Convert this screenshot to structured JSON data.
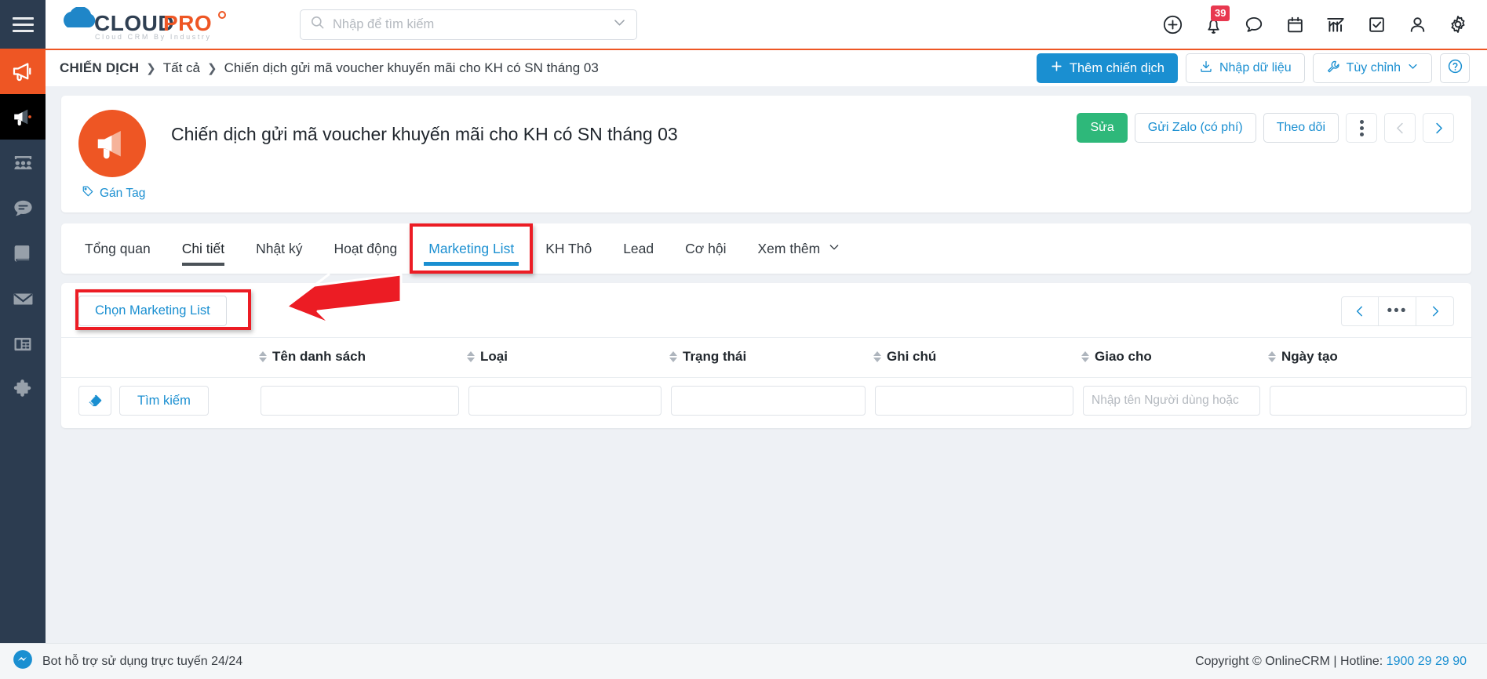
{
  "brand": {
    "name": "CLOUDPRO",
    "tagline": "Cloud CRM By Industry"
  },
  "topbar": {
    "menu_icon": "hamburger-icon",
    "search": {
      "placeholder": "Nhập để tìm kiếm",
      "value": ""
    },
    "icons": [
      {
        "name": "add-icon",
        "label": ""
      },
      {
        "name": "notification-bell-icon",
        "badge": "39"
      },
      {
        "name": "chat-bubble-icon",
        "label": ""
      },
      {
        "name": "calendar-icon",
        "label": ""
      },
      {
        "name": "analytics-chart-icon",
        "label": ""
      },
      {
        "name": "task-checkbox-icon",
        "label": ""
      },
      {
        "name": "user-profile-icon",
        "label": ""
      },
      {
        "name": "settings-gear-icon",
        "label": ""
      }
    ]
  },
  "sidebar": {
    "items": [
      {
        "name": "campaign-megaphone-icon",
        "state": "active"
      },
      {
        "name": "campaign-sub-megaphone-icon",
        "state": "sub"
      },
      {
        "name": "customers-group-icon",
        "state": ""
      },
      {
        "name": "chat-message-icon",
        "state": ""
      },
      {
        "name": "book-icon",
        "state": ""
      },
      {
        "name": "email-envelope-icon",
        "state": ""
      },
      {
        "name": "news-article-icon",
        "state": ""
      },
      {
        "name": "puzzle-extension-icon",
        "state": ""
      }
    ]
  },
  "breadcrumb": {
    "root": "CHIẾN DỊCH",
    "sep": "❯",
    "level1": "Tất cả",
    "level2": "Chiến dịch gửi mã voucher khuyến mãi cho KH có SN tháng 03"
  },
  "crumb_actions": {
    "add_campaign": "Thêm chiến dịch",
    "add_campaign_icon": "plus-icon",
    "import": "Nhập dữ liệu",
    "import_icon": "download-import-icon",
    "customize": "Tùy chỉnh",
    "customize_icon": "wrench-icon",
    "customize_chevron": "chevron-down-icon",
    "help_icon": "question-circle-icon"
  },
  "campaign": {
    "avatar_icon": "megaphone-icon",
    "avatar_color": "#ee5624",
    "title": "Chiến dịch gửi mã voucher khuyến mãi cho KH có SN tháng 03",
    "tag_link": "Gán Tag",
    "tag_icon": "tag-icon",
    "actions": {
      "edit": "Sửa",
      "send_zalo": "Gửi Zalo (có phí)",
      "follow": "Theo dõi",
      "more_icon": "kebab-menu-icon",
      "prev_icon": "chevron-left-icon",
      "next_icon": "chevron-right-icon"
    }
  },
  "tabs": [
    {
      "label": "Tổng quan",
      "state": ""
    },
    {
      "label": "Chi tiết",
      "state": "active-dark"
    },
    {
      "label": "Nhật ký",
      "state": ""
    },
    {
      "label": "Hoạt động",
      "state": ""
    },
    {
      "label": "Marketing List",
      "state": "selected"
    },
    {
      "label": "KH Thô",
      "state": ""
    },
    {
      "label": "Lead",
      "state": ""
    },
    {
      "label": "Cơ hội",
      "state": ""
    },
    {
      "label": "Xem thêm",
      "state": "dropdown"
    }
  ],
  "list_panel": {
    "choose_button": "Chọn Marketing List",
    "pager": {
      "prev_icon": "chevron-left-icon",
      "more_icon": "ellipsis-icon",
      "more_label": "•••",
      "next_icon": "chevron-right-icon"
    },
    "columns": [
      {
        "label": "Tên danh sách",
        "sortable": true
      },
      {
        "label": "Loại",
        "sortable": true
      },
      {
        "label": "Trạng thái",
        "sortable": true
      },
      {
        "label": "Ghi chú",
        "sortable": true
      },
      {
        "label": "Giao cho",
        "sortable": true
      },
      {
        "label": "Ngày tạo",
        "sortable": true
      }
    ],
    "search_row": {
      "clear_icon": "eraser-icon",
      "search_label": "Tìm kiếm",
      "filters": [
        {
          "placeholder": "",
          "value": ""
        },
        {
          "placeholder": "",
          "value": ""
        },
        {
          "placeholder": "",
          "value": ""
        },
        {
          "placeholder": "",
          "value": ""
        },
        {
          "placeholder": "Nhập tên Người dùng hoặc",
          "value": ""
        },
        {
          "placeholder": "",
          "value": ""
        }
      ]
    }
  },
  "annotations": {
    "red_box_tab": "Marketing List",
    "red_box_button": "Chọn Marketing List",
    "arrow": "red-arrow-pointing-left",
    "accent_red": "#ec1c24"
  },
  "footer": {
    "bot_icon": "messenger-bot-icon",
    "bot_text": "Bot hỗ trợ sử dụng trực tuyến 24/24",
    "copyright": "Copyright © OnlineCRM | Hotline: ",
    "hotline": "1900 29 29 90"
  },
  "colors": {
    "brand_blue": "#1a8fd1",
    "brand_orange": "#ee5624",
    "sidebar": "#2c3c50",
    "green": "#2eb87a",
    "badge_red": "#e8384f"
  }
}
